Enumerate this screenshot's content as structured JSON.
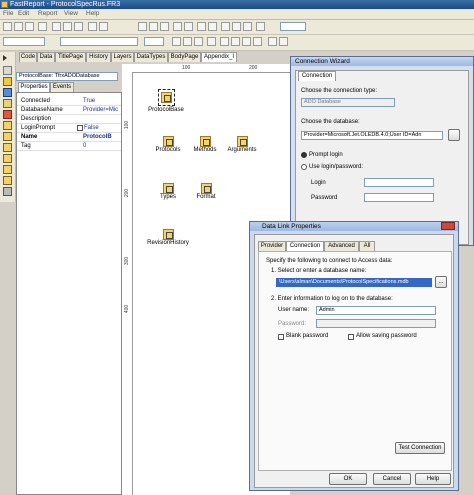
{
  "window": {
    "title": "FastReport - ProtocolSpecRus.FR3"
  },
  "menu": [
    "File",
    "Edit",
    "Report",
    "View",
    "Help"
  ],
  "tabs": [
    "Code",
    "Data",
    "TitlePage",
    "History",
    "Layers",
    "DataTypes",
    "BodyPage",
    "Appendix_I"
  ],
  "inspector": {
    "selector": "ProtocolBase: TfrxADODatabase",
    "subtabs": [
      "Properties",
      "Events"
    ],
    "rows": [
      {
        "k": "Connected",
        "v": "True"
      },
      {
        "k": "DatabaseName",
        "v": "Provider=Mic"
      },
      {
        "k": "Description",
        "v": ""
      },
      {
        "k": "LoginPrompt",
        "v": "False"
      },
      {
        "k": "Name",
        "v": "ProtocolB"
      },
      {
        "k": "Tag",
        "v": "0"
      }
    ]
  },
  "ruler": {
    "h": [
      "100",
      "200"
    ],
    "v": [
      "100",
      "200",
      "300",
      "400"
    ]
  },
  "components": [
    {
      "label": "ProtocolBase"
    },
    {
      "label": "Protocols"
    },
    {
      "label": "Methods"
    },
    {
      "label": "Arguments"
    },
    {
      "label": "Types"
    },
    {
      "label": "Format"
    },
    {
      "label": "RevisionHistory"
    }
  ],
  "wizard": {
    "title": "Connection Wizard",
    "tab": "Connection",
    "conn_type_label": "Choose the connection type:",
    "conn_type_value": "ADO Database",
    "db_label": "Choose the database:",
    "db_value": "Provider=Microsoft.Jet.OLEDB.4.0;User ID=Adn",
    "prompt_login": "Prompt login",
    "use_login": "Use login/password:",
    "login_label": "Login",
    "password_label": "Password"
  },
  "dlp": {
    "title": "Data Link Properties",
    "tabs": [
      "Provider",
      "Connection",
      "Advanced",
      "All"
    ],
    "intro": "Specify the following to connect to Access data:",
    "step1": "1. Select or enter a database name:",
    "db_path": "\\Users\\alman\\Documents\\ProtocolSpecifications.mdb",
    "browse": "...",
    "step2": "2. Enter information to log on to the database:",
    "user_label": "User name:",
    "user_value": "Admin",
    "pass_label": "Password:",
    "blank_password": "Blank password",
    "allow_saving": "Allow saving password",
    "test": "Test Connection",
    "ok": "OK",
    "cancel": "Cancel",
    "help": "Help"
  }
}
